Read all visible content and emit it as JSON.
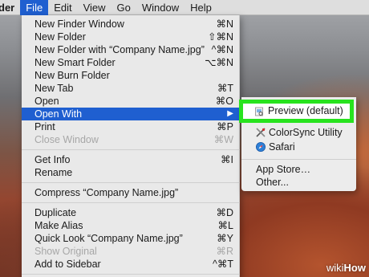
{
  "menubar": {
    "items": [
      "der",
      "File",
      "Edit",
      "View",
      "Go",
      "Window",
      "Help"
    ]
  },
  "file_menu": {
    "items": [
      {
        "label": "New Finder Window",
        "shortcut": "⌘N"
      },
      {
        "label": "New Folder",
        "shortcut": "⇧⌘N"
      },
      {
        "label": "New Folder with “Company Name.jpg”",
        "shortcut": "^⌘N"
      },
      {
        "label": "New Smart Folder",
        "shortcut": "⌥⌘N"
      },
      {
        "label": "New Burn Folder",
        "shortcut": ""
      },
      {
        "label": "New Tab",
        "shortcut": "⌘T"
      },
      {
        "label": "Open",
        "shortcut": "⌘O"
      },
      {
        "label": "Open With",
        "shortcut": "▶"
      },
      {
        "label": "Print",
        "shortcut": "⌘P"
      },
      {
        "label": "Close Window",
        "shortcut": "⌘W"
      },
      {
        "label": "Get Info",
        "shortcut": "⌘I"
      },
      {
        "label": "Rename",
        "shortcut": ""
      },
      {
        "label": "Compress “Company Name.jpg”",
        "shortcut": ""
      },
      {
        "label": "Duplicate",
        "shortcut": "⌘D"
      },
      {
        "label": "Make Alias",
        "shortcut": "⌘L"
      },
      {
        "label": "Quick Look “Company Name.jpg”",
        "shortcut": "⌘Y"
      },
      {
        "label": "Show Original",
        "shortcut": "⌘R"
      },
      {
        "label": "Add to Sidebar",
        "shortcut": "^⌘T"
      }
    ]
  },
  "open_with_submenu": {
    "items": [
      {
        "label": "Preview (default)",
        "icon": "preview-app-icon"
      },
      {
        "label": "ColorSync Utility",
        "icon": "colorsync-app-icon"
      },
      {
        "label": "Safari",
        "icon": "safari-app-icon"
      },
      {
        "label": "App Store…"
      },
      {
        "label": "Other..."
      }
    ]
  },
  "watermark": {
    "prefix": "wiki",
    "suffix": "How"
  },
  "colors": {
    "highlight": "#1f5fd0",
    "green_box": "#28e31e",
    "menu_bg": "#e9e9e9"
  }
}
